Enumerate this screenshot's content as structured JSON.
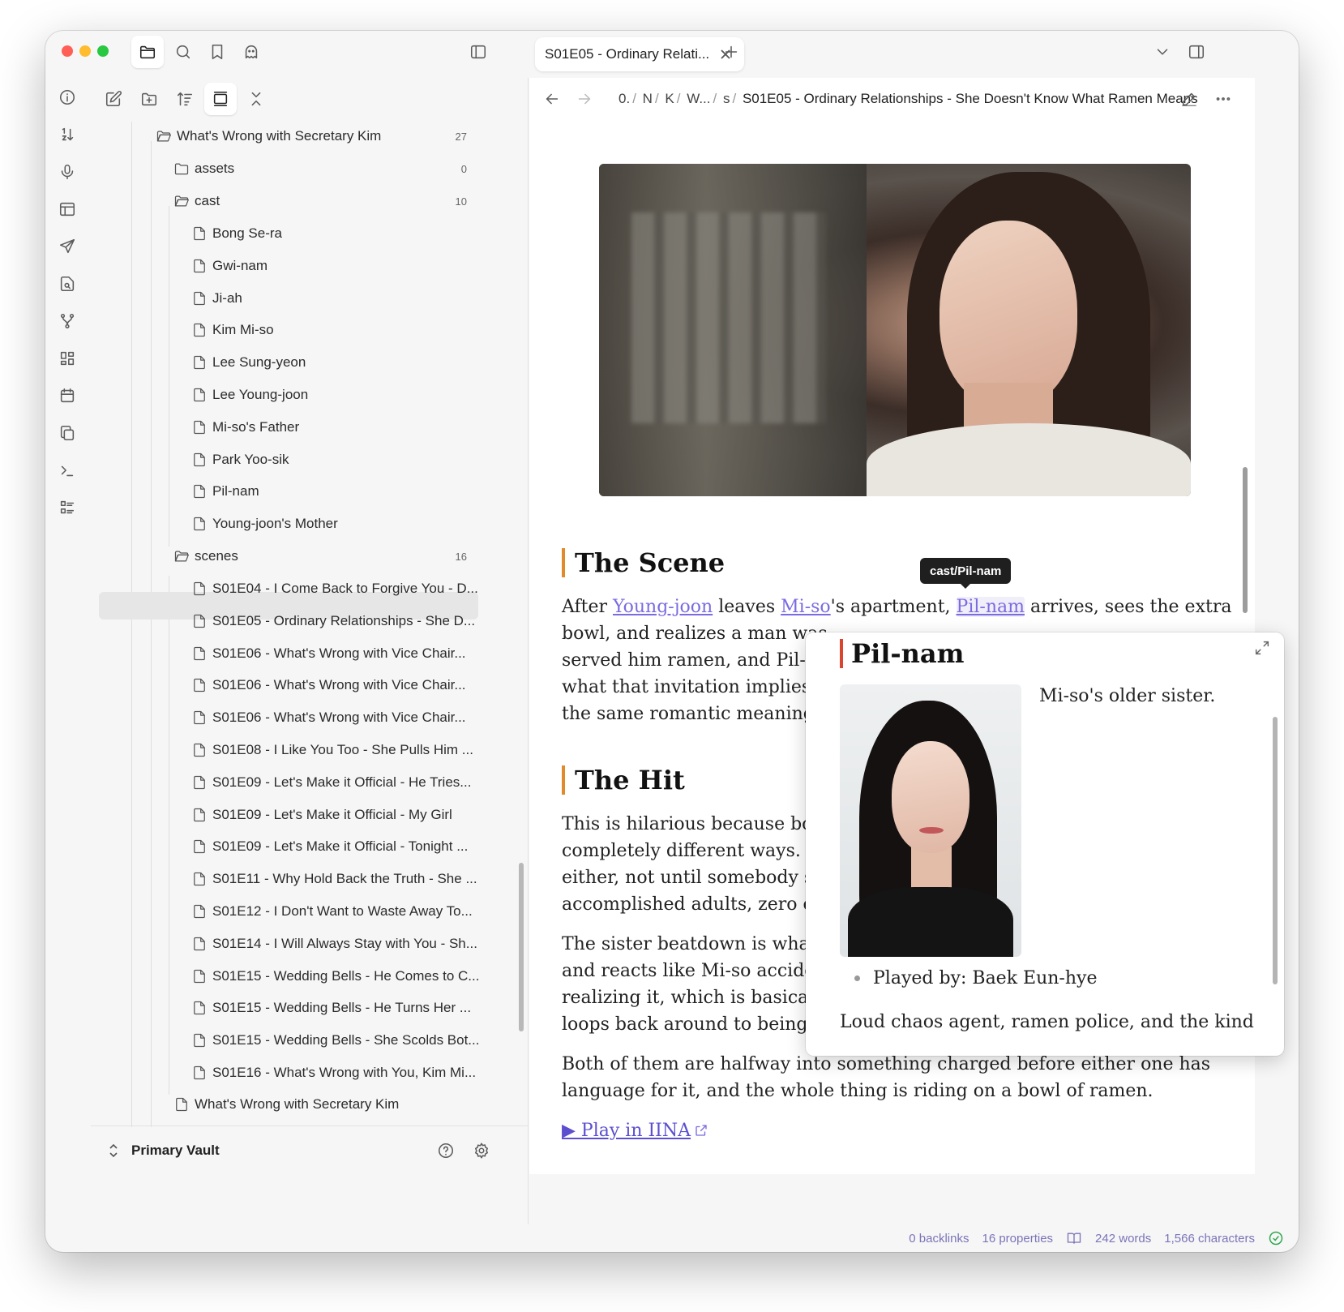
{
  "tab": {
    "title": "S01E05 - Ordinary Relati..."
  },
  "breadcrumb": {
    "parts": [
      "0.",
      "N",
      "K",
      "W...",
      "s"
    ],
    "current": "S01E05 - Ordinary Relationships - She Doesn't Know What Ramen Means"
  },
  "tree": {
    "root": {
      "label": "What's Wrong with Secretary Kim",
      "count": "27"
    },
    "assets": {
      "label": "assets",
      "count": "0"
    },
    "cast": {
      "label": "cast",
      "count": "10"
    },
    "cast_files": [
      "Bong Se-ra",
      "Gwi-nam",
      "Ji-ah",
      "Kim Mi-so",
      "Lee Sung-yeon",
      "Lee Young-joon",
      "Mi-so's Father",
      "Park Yoo-sik",
      "Pil-nam",
      "Young-joon's Mother"
    ],
    "scenes": {
      "label": "scenes",
      "count": "16"
    },
    "scene_files": [
      "S01E04 - I Come Back to Forgive You - D...",
      "S01E05 - Ordinary Relationships - She D...",
      "S01E06 - What's Wrong with Vice Chair...",
      "S01E06 - What's Wrong with Vice Chair...",
      "S01E06 - What's Wrong with Vice Chair...",
      "S01E08 - I Like You Too - She Pulls Him ...",
      "S01E09 - Let's Make it Official - He Tries...",
      "S01E09 - Let's Make it Official - My Girl",
      "S01E09 - Let's Make it Official - Tonight ...",
      "S01E11 - Why Hold Back the Truth - She ...",
      "S01E12 - I Don't Want to Waste Away To...",
      "S01E14 - I Will Always Stay with You - Sh...",
      "S01E15 - Wedding Bells - He Comes to C...",
      "S01E15 - Wedding Bells - He Turns Her ...",
      "S01E15 - Wedding Bells - She Scolds Bot...",
      "S01E16 - What's Wrong with You, Kim Mi..."
    ],
    "last_file": "What's Wrong with Secretary Kim"
  },
  "vault": {
    "name": "Primary Vault"
  },
  "article": {
    "h_scene": "The Scene",
    "p1_a": "After ",
    "p1_link1": "Young-joon",
    "p1_b": " leaves ",
    "p1_link2": "Mi-so",
    "p1_c": "'s apartment, ",
    "p1_link3": "Pil-nam",
    "p1_d": " arrives, sees the extra",
    "p1_line2": "bowl, and realizes a man was",
    "p1_line3": "served him ramen, and Pil-na",
    "p1_line4": "what that invitation implies.",
    "p1_line5": "the same romantic meaning",
    "h_hit": "The Hit",
    "p2_line1": "This is hilarious because bot",
    "p2_line2": "completely different ways. Sl",
    "p2_line3": "either, not until somebody sp",
    "p2_line4": "accomplished adults, zero clu",
    "p3_line1": "The sister beatdown is what",
    "p3_line2": "and reacts like Mi-so acciden",
    "p3_line3": "realizing it, which is basically",
    "p3_line4": "loops back around to being h",
    "p4_line1": "Both of them are halfway into something charged before either one has",
    "p4_line2": "language for it, and the whole thing is riding on a bowl of ramen.",
    "play_link": "▶ Play in IINA"
  },
  "tooltip": {
    "text": "cast/Pil-nam"
  },
  "popover": {
    "title": "Pil-nam",
    "description": "Mi-so's older sister.",
    "bullet": "Played by: Baek Eun-hye",
    "extra": "Loud chaos agent, ramen police, and the kind"
  },
  "status": {
    "backlinks": "0 backlinks",
    "properties": "16 properties",
    "words": "242 words",
    "characters": "1,566 characters"
  },
  "colors": {
    "accent": "#7b6be0",
    "heading_bar": "#e08a2b",
    "popover_bar": "#d9452f",
    "status_ok": "#2fa84f"
  }
}
